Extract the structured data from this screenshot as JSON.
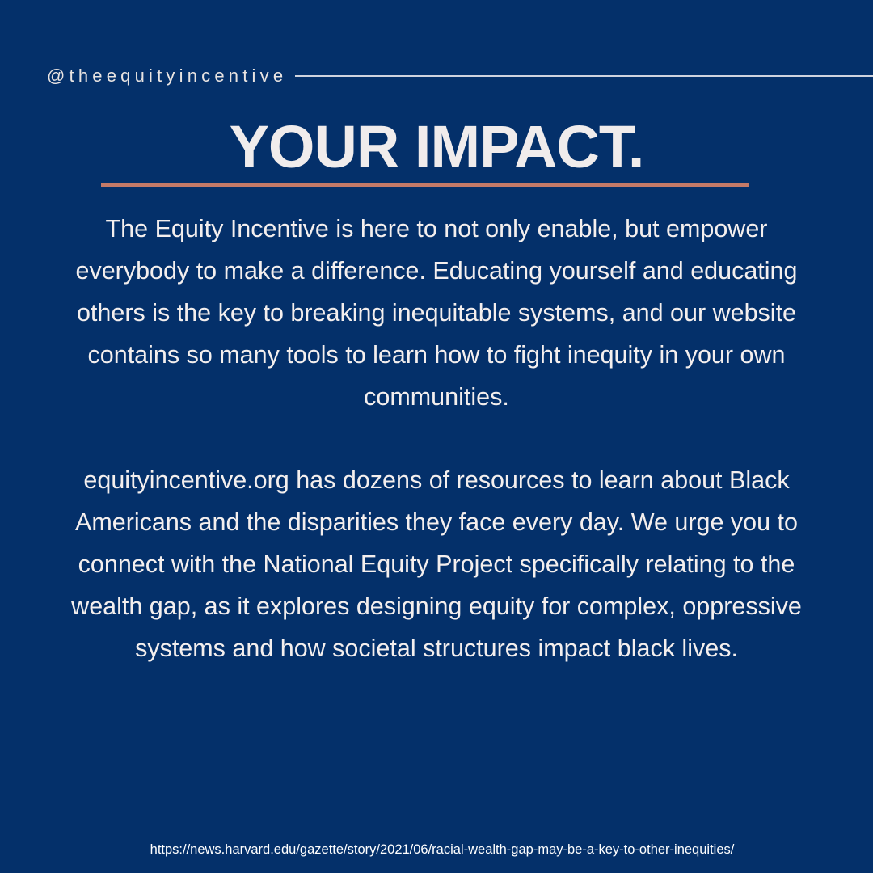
{
  "header": {
    "handle": "@theequityincentive"
  },
  "main": {
    "title": "YOUR IMPACT.",
    "paragraph_1": "The Equity Incentive is here to not only enable, but empower everybody to make a difference. Educating yourself and educating others is the key to breaking inequitable systems, and our website contains so many tools to learn how to fight inequity in your own communities.",
    "paragraph_2": "equityincentive.org has dozens of resources to learn about Black Americans and the disparities they face every day. We urge you to connect with the National Equity Project specifically relating to the wealth gap, as it explores designing equity for complex, oppressive systems and how societal structures impact black lives."
  },
  "footer": {
    "source_url": "https://news.harvard.edu/gazette/story/2021/06/racial-wealth-gap-may-be-a-key-to-other-inequities/"
  },
  "colors": {
    "background": "#04306a",
    "accent_underline": "#c47a68",
    "text": "#f4efee"
  }
}
